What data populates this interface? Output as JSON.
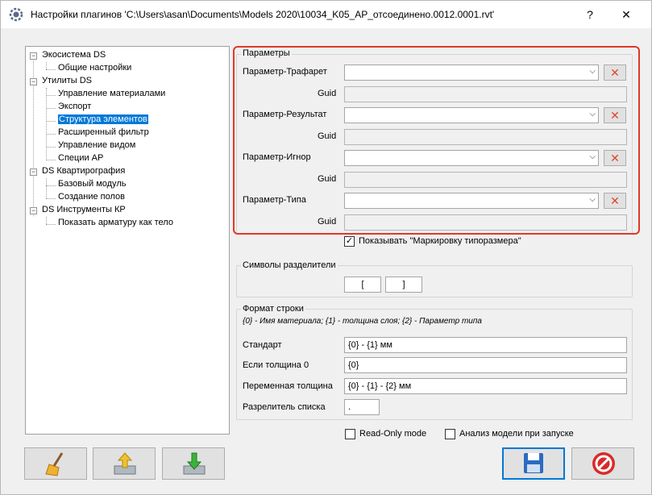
{
  "window": {
    "title": "Настройки плагинов 'C:\\Users\\asan\\Documents\\Models 2020\\10034_K05_AP_отсоединено.0012.0001.rvt'",
    "help_label": "?",
    "close_label": "✕"
  },
  "tree": {
    "nodes": [
      {
        "label": "Экосистема DS",
        "expander": "−"
      },
      {
        "label": "Общие настройки"
      },
      {
        "label": "Утилиты DS",
        "expander": "−"
      },
      {
        "label": "Управление материалами"
      },
      {
        "label": "Экспорт"
      },
      {
        "label": "Структура элементов",
        "selected": true
      },
      {
        "label": "Расширенный фильтр"
      },
      {
        "label": "Управление видом"
      },
      {
        "label": "Специи АР"
      },
      {
        "label": "DS Квартирография",
        "expander": "−"
      },
      {
        "label": "Базовый модуль"
      },
      {
        "label": "Создание полов"
      },
      {
        "label": "DS Инструменты КР",
        "expander": "−"
      },
      {
        "label": "Показать арматуру как тело"
      }
    ]
  },
  "params": {
    "title": "Параметры",
    "guid_label": "Guid",
    "delete_icon": "✕",
    "rows": [
      {
        "label": "Параметр-Трафарет",
        "value": ""
      },
      {
        "label": "Параметр-Результат",
        "value": ""
      },
      {
        "label": "Параметр-Игнор",
        "value": ""
      },
      {
        "label": "Параметр-Типа",
        "value": ""
      }
    ]
  },
  "show_marking": {
    "label": "Показывать \"Маркировку типоразмера\"",
    "checked": true,
    "check": "✓"
  },
  "separators": {
    "title": "Символы разделители",
    "left": "[",
    "right": "]"
  },
  "format": {
    "title": "Формат строки",
    "hint": "{0} - Имя материала; {1} - толщина слоя; {2} - Параметр типа",
    "standard_label": "Стандарт",
    "standard_value": "{0} - {1} мм",
    "zero_label": "Если толщина 0",
    "zero_value": "{0}",
    "variable_label": "Переменная толщина",
    "variable_value": "{0} - {1} - {2} мм",
    "list_sep_label": "Разрелитель списка",
    "list_sep_value": "."
  },
  "options": {
    "readonly_label": "Read-Only mode",
    "analyze_label": "Анализ модели при запуске"
  },
  "colors": {
    "accent": "#0078d7",
    "highlight": "#e0382b",
    "delete": "#e0472a"
  }
}
